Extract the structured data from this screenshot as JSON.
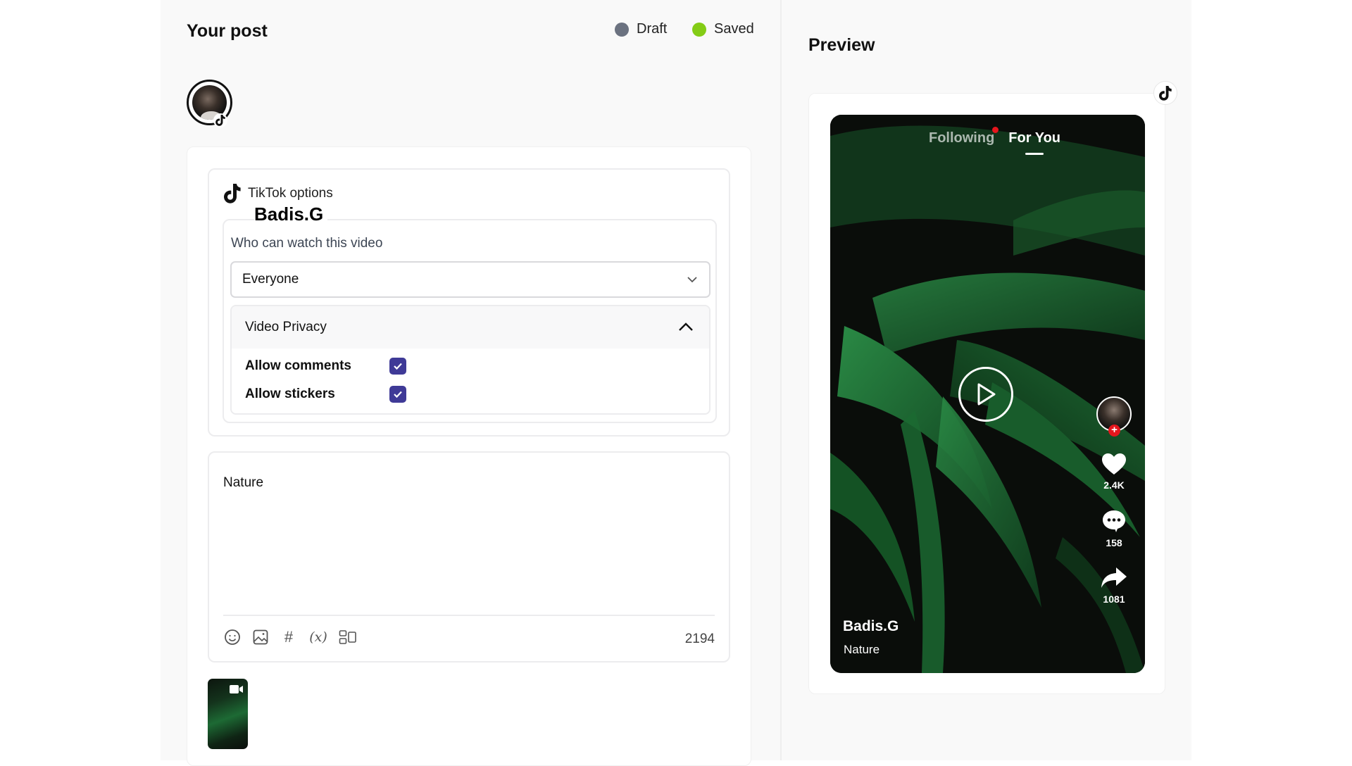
{
  "editor": {
    "title": "Your post",
    "statuses": [
      {
        "label": "Draft",
        "color": "#6b7280"
      },
      {
        "label": "Saved",
        "color": "#84cc16"
      }
    ],
    "tiktok_options": {
      "heading": "TikTok options",
      "account_name": "Badis.G",
      "visibility_label": "Who can watch this video",
      "visibility_value": "Everyone",
      "privacy": {
        "heading": "Video Privacy",
        "expanded": true,
        "options": [
          {
            "label": "Allow comments",
            "checked": true
          },
          {
            "label": "Allow stickers",
            "checked": true
          }
        ]
      }
    },
    "caption": "Nature",
    "toolbar": [
      "emoji-icon",
      "image-icon",
      "hashtag-icon",
      "variable-icon",
      "snippet-icon"
    ],
    "toolbar_glyphs": {
      "hashtag": "#",
      "variable": "(x)"
    },
    "char_count": "2194",
    "media": [
      {
        "type": "video",
        "description": "Green palm leaves"
      }
    ],
    "accent_color": "#3f3a97"
  },
  "preview": {
    "title": "Preview",
    "platform": "TikTok",
    "tabs": {
      "following": "Following",
      "for_you": "For You",
      "active": "For You"
    },
    "stats": {
      "likes": "2.4K",
      "comments": "158",
      "shares": "1081"
    },
    "username": "Badis.G",
    "caption": "Nature"
  }
}
